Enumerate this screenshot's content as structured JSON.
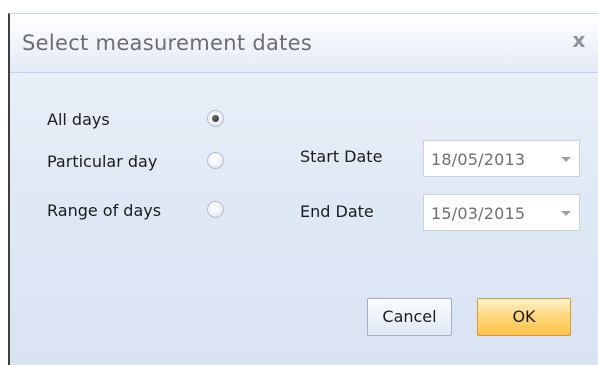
{
  "dialog": {
    "title": "Select measurement dates",
    "close_symbol": "x"
  },
  "options": {
    "items": [
      {
        "label": "All days",
        "selected": true
      },
      {
        "label": "Particular day",
        "selected": false
      },
      {
        "label": "Range of days",
        "selected": false
      }
    ]
  },
  "dates": {
    "start_label": "Start Date",
    "start_value": "18/05/2013",
    "end_label": "End Date",
    "end_value": "15/03/2015"
  },
  "buttons": {
    "cancel_label": "Cancel",
    "ok_label": "OK"
  },
  "colors": {
    "ok_accent": "#ffc24a",
    "panel": "#dfe8f5"
  }
}
